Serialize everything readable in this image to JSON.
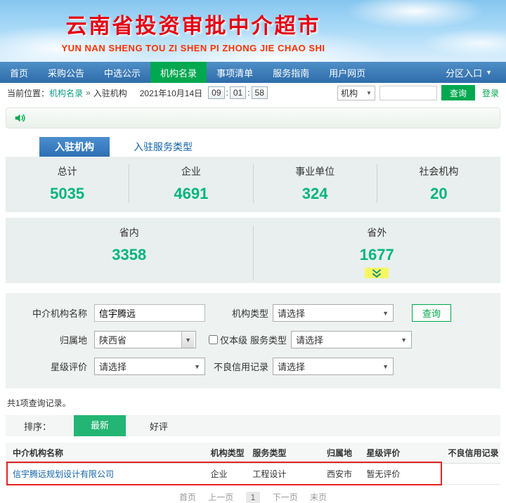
{
  "header": {
    "title": "云南省投资审批中介超市",
    "subtitle": "YUN NAN SHENG TOU ZI SHEN PI ZHONG JIE CHAO SHI"
  },
  "nav": {
    "items": [
      {
        "label": "首页"
      },
      {
        "label": "采购公告"
      },
      {
        "label": "中选公示"
      },
      {
        "label": "机构名录"
      },
      {
        "label": "事项清单"
      },
      {
        "label": "服务指南"
      },
      {
        "label": "用户网页"
      }
    ],
    "active_index": 3,
    "zone_entry": "分区入口"
  },
  "breadcrumb": {
    "prefix": "当前位置：",
    "link": "机构名录",
    "separator": "»",
    "current": "入驻机构",
    "date": "2021年10月14日",
    "time": {
      "hh": "09",
      "mm": "01",
      "ss": "58",
      "sep": ":"
    }
  },
  "top_search": {
    "category_value": "机构",
    "query_button": "查询",
    "login_link": "登录"
  },
  "tabs": {
    "tab_orgs": "入驻机构",
    "tab_services": "入驻服务类型"
  },
  "stats_primary": [
    {
      "label": "总计",
      "value": "5035"
    },
    {
      "label": "企业",
      "value": "4691"
    },
    {
      "label": "事业单位",
      "value": "324"
    },
    {
      "label": "社会机构",
      "value": "20"
    }
  ],
  "stats_secondary": [
    {
      "label": "省内",
      "value": "3358"
    },
    {
      "label": "省外",
      "value": "1677"
    }
  ],
  "filter_form": {
    "name_label": "中介机构名称",
    "name_value": "信宇腾远",
    "org_type_label": "机构类型",
    "org_type_value": "请选择",
    "query_button": "查询",
    "region_label": "归属地",
    "region_value": "陕西省",
    "local_only_label": "仅本级",
    "service_type_label": "服务类型",
    "service_type_value": "请选择",
    "star_label": "星级评价",
    "star_value": "请选择",
    "credit_label": "不良信用记录",
    "credit_value": "请选择"
  },
  "results": {
    "count_text": "共1项查询记录。"
  },
  "sort": {
    "label": "排序：",
    "newest": "最新",
    "praise": "好评"
  },
  "table": {
    "headers": [
      "中介机构名称",
      "机构类型",
      "服务类型",
      "归属地",
      "星级评价",
      "不良信用记录"
    ],
    "rows": [
      [
        "信宇腾远规划设计有限公司",
        "企业",
        "工程设计",
        "西安市",
        "暂无评价",
        ""
      ]
    ]
  },
  "pagination": {
    "first": "首页",
    "prev": "上一页",
    "page": "1",
    "next": "下一页",
    "last": "末页"
  },
  "icons": {
    "dropdown_arrow": "▼",
    "select_arrow": "▼"
  },
  "colors": {
    "accent_green": "#00a84f",
    "stat_green": "#00b57d",
    "nav_blue": "#2e6cab",
    "title_red": "#e60012",
    "link_blue": "#1464a8",
    "annotation_red": "#e8251f",
    "highlight_yellow": "#f7f763"
  }
}
